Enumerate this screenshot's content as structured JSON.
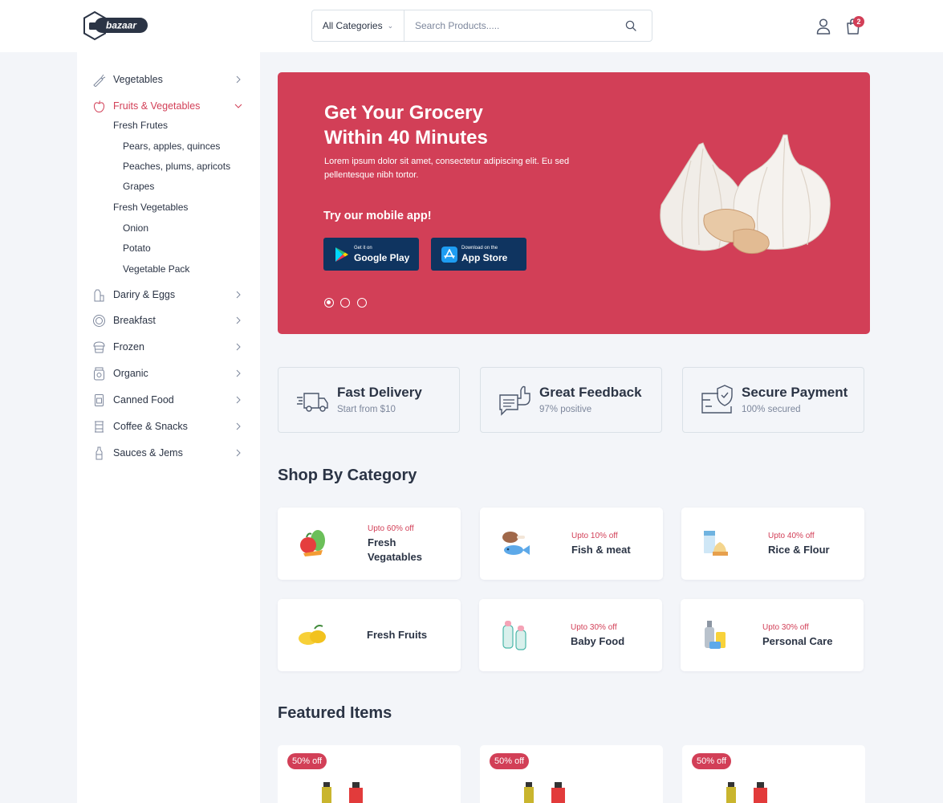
{
  "header": {
    "logo_text": "bazaar",
    "search": {
      "category": "All Categories",
      "placeholder": "Search Products....."
    },
    "cart_count": "2"
  },
  "sidebar": {
    "categories": [
      {
        "label": "Vegetables",
        "icon": "carrot-icon"
      },
      {
        "label": "Fruits & Vegetables",
        "icon": "apple-icon",
        "active": true,
        "subcategories": [
          {
            "label": "Fresh Frutes",
            "items": [
              "Pears, apples, quinces",
              "Peaches, plums, apricots",
              "Grapes"
            ]
          },
          {
            "label": "Fresh Vegetables",
            "items": [
              "Onion",
              "Potato",
              "Vegetable Pack"
            ]
          }
        ]
      },
      {
        "label": "Dariry & Eggs",
        "icon": "milk-icon"
      },
      {
        "label": "Breakfast",
        "icon": "breakfast-icon"
      },
      {
        "label": "Frozen",
        "icon": "frozen-icon"
      },
      {
        "label": "Organic",
        "icon": "organic-icon"
      },
      {
        "label": "Canned Food",
        "icon": "can-icon"
      },
      {
        "label": "Coffee & Snacks",
        "icon": "coffee-icon"
      },
      {
        "label": "Sauces & Jems",
        "icon": "sauce-icon"
      }
    ]
  },
  "hero": {
    "title_line1": "Get Your Grocery",
    "title_line2": "Within 40 Minutes",
    "description": "Lorem ipsum dolor sit amet, consectetur adipiscing elit. Eu sed pellentesque nibh tortor.",
    "app_heading": "Try our mobile app!",
    "google_play": {
      "small": "Get it on",
      "big": "Google Play"
    },
    "app_store": {
      "small": "Download on the",
      "big": "App Store"
    },
    "slide_count": 3,
    "active_slide": 1
  },
  "services": [
    {
      "title": "Fast Delivery",
      "subtitle": "Start from $10",
      "icon": "delivery-truck-icon"
    },
    {
      "title": "Great Feedback",
      "subtitle": "97% positive",
      "icon": "feedback-icon"
    },
    {
      "title": "Secure Payment",
      "subtitle": "100% secured",
      "icon": "secure-payment-icon"
    }
  ],
  "shop_by_category": {
    "title": "Shop By Category",
    "items": [
      {
        "offer": "Upto 60% off",
        "name_line1": "Fresh",
        "name_line2": "Vegatables"
      },
      {
        "offer": "Upto 10% off",
        "name_line1": "Fish & meat"
      },
      {
        "offer": "Upto 40% off",
        "name_line1": "Rice & Flour"
      },
      {
        "offer": "",
        "name_line1": "Fresh Fruits"
      },
      {
        "offer": "Upto 30% off",
        "name_line1": "Baby Food"
      },
      {
        "offer": "Upto 30% off",
        "name_line1": "Personal Care"
      }
    ]
  },
  "featured": {
    "title": "Featured Items",
    "items": [
      {
        "badge": "50% off"
      },
      {
        "badge": "50% off"
      },
      {
        "badge": "50% off"
      }
    ]
  },
  "colors": {
    "primary": "#D23F57",
    "navy": "#0F3460",
    "text": "#2B3445",
    "muted": "#7D879C",
    "background": "#F3F5F9"
  }
}
